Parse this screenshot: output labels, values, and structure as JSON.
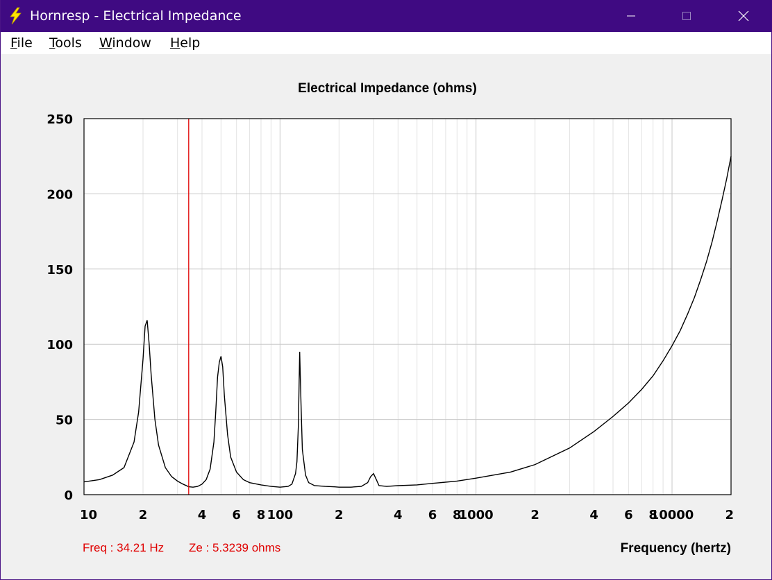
{
  "window": {
    "title": "Hornresp - Electrical Impedance",
    "titlebar_color": "#3f0a82",
    "icon": "lightning-bolt-icon",
    "controls": [
      "minimize-icon",
      "maximize-icon",
      "close-icon"
    ]
  },
  "menu": {
    "items": [
      {
        "mnemonic": "F",
        "rest": "ile"
      },
      {
        "mnemonic": "T",
        "rest": "ools"
      },
      {
        "mnemonic": "W",
        "rest": "indow"
      },
      {
        "mnemonic": "H",
        "rest": "elp"
      }
    ]
  },
  "status": {
    "freq_text": "Freq : 34.21 Hz",
    "ze_text": "Ze : 5.3239 ohms",
    "color": "#e00000"
  },
  "chart_data": {
    "type": "line",
    "title": "Electrical Impedance (ohms)",
    "xlabel": "Frequency (hertz)",
    "ylabel": "",
    "x_scale": "log",
    "xlim": [
      10,
      20000
    ],
    "ylim": [
      0,
      250
    ],
    "grid": true,
    "y_ticks": [
      0,
      50,
      100,
      150,
      200,
      250
    ],
    "x_ticks": [
      {
        "value": 10,
        "label": "10"
      },
      {
        "value": 20,
        "label": "2"
      },
      {
        "value": 40,
        "label": "4"
      },
      {
        "value": 60,
        "label": "6"
      },
      {
        "value": 80,
        "label": "8"
      },
      {
        "value": 100,
        "label": "100"
      },
      {
        "value": 200,
        "label": "2"
      },
      {
        "value": 400,
        "label": "4"
      },
      {
        "value": 600,
        "label": "6"
      },
      {
        "value": 800,
        "label": "8"
      },
      {
        "value": 1000,
        "label": "1000"
      },
      {
        "value": 2000,
        "label": "2"
      },
      {
        "value": 4000,
        "label": "4"
      },
      {
        "value": 6000,
        "label": "6"
      },
      {
        "value": 8000,
        "label": "8"
      },
      {
        "value": 10000,
        "label": "10000"
      },
      {
        "value": 20000,
        "label": "2"
      }
    ],
    "cursor": {
      "x": 34.21,
      "color": "#e00000"
    },
    "line_color": "#000000",
    "series": [
      {
        "x": [
          10,
          12,
          14,
          16,
          18,
          19,
          20,
          20.5,
          21,
          21.5,
          22,
          23,
          24,
          26,
          28,
          30,
          32,
          34.21,
          36,
          38,
          40,
          42,
          44,
          46,
          47,
          48,
          49,
          50,
          51,
          52,
          54,
          56,
          60,
          65,
          70,
          80,
          90,
          100,
          110,
          115,
          120,
          122,
          124,
          125,
          126,
          128,
          130,
          135,
          140,
          150,
          170,
          190,
          200,
          230,
          260,
          280,
          290,
          300,
          310,
          320,
          350,
          400,
          500,
          600,
          800,
          1000,
          1500,
          2000,
          3000,
          4000,
          5000,
          6000,
          7000,
          8000,
          9000,
          10000,
          11000,
          12000,
          13000,
          14000,
          15000,
          16000,
          17000,
          18000,
          19000,
          20000
        ],
        "y": [
          8.5,
          10,
          13,
          18,
          35,
          55,
          90,
          112,
          116,
          100,
          80,
          50,
          33,
          18,
          12,
          9,
          7,
          5.3,
          5,
          5.5,
          7,
          10,
          17,
          35,
          55,
          78,
          88,
          92,
          85,
          66,
          40,
          25,
          15,
          10,
          8,
          6.5,
          5.5,
          5,
          5.5,
          7,
          14,
          22,
          45,
          70,
          95,
          60,
          30,
          13,
          8,
          6,
          5.5,
          5.2,
          5,
          5,
          5.5,
          8,
          12,
          14,
          10,
          6,
          5.5,
          6,
          6.5,
          7.5,
          9,
          11,
          15,
          20,
          31,
          42,
          52,
          61,
          70,
          79,
          89,
          99,
          109,
          120,
          131,
          143,
          155,
          168,
          182,
          196,
          210,
          225
        ]
      }
    ]
  }
}
